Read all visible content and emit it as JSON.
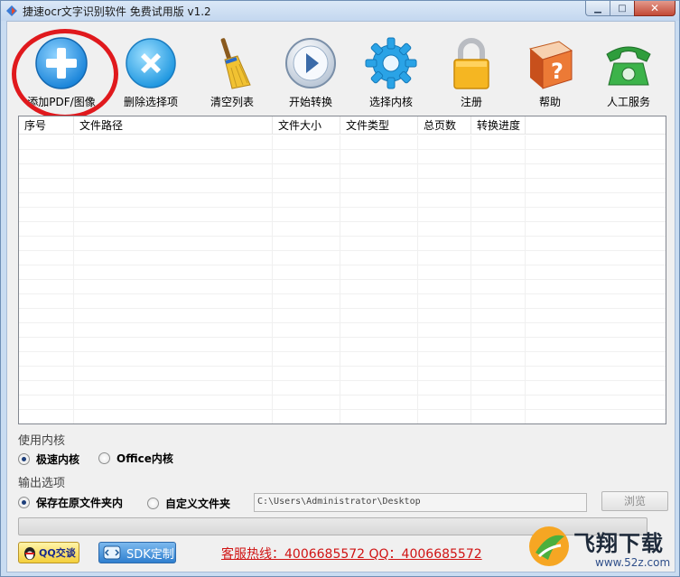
{
  "window": {
    "title": "捷速ocr文字识别软件 免费试用版 v1.2"
  },
  "toolbar": {
    "items": [
      {
        "label": "添加PDF/图像",
        "icon": "add-icon"
      },
      {
        "label": "删除选择项",
        "icon": "delete-icon"
      },
      {
        "label": "清空列表",
        "icon": "broom-icon"
      },
      {
        "label": "开始转换",
        "icon": "play-icon"
      },
      {
        "label": "选择内核",
        "icon": "gear-icon"
      },
      {
        "label": "注册",
        "icon": "lock-icon"
      },
      {
        "label": "帮助",
        "icon": "help-book-icon"
      },
      {
        "label": "人工服务",
        "icon": "phone-icon"
      }
    ]
  },
  "table": {
    "columns": [
      "序号",
      "文件路径",
      "文件大小",
      "文件类型",
      "总页数",
      "转换进度"
    ],
    "rows": []
  },
  "engine": {
    "section_label": "使用内核",
    "options": [
      {
        "label": "极速内核",
        "checked": true
      },
      {
        "label": "Office内核",
        "checked": false
      }
    ]
  },
  "output": {
    "section_label": "输出选项",
    "options": [
      {
        "label": "保存在原文件夹内",
        "checked": true
      },
      {
        "label": "自定义文件夹",
        "checked": false
      }
    ],
    "path": "C:\\Users\\Administrator\\Desktop",
    "browse_label": "浏览"
  },
  "progress": {
    "value": 0
  },
  "footer": {
    "qq_label": "QQ交谈",
    "sdk_label": "SDK定制",
    "hotline": "客服热线：4006685572 QQ：4006685572"
  },
  "watermark": {
    "text": "飞翔下载",
    "url": "www.52z.com"
  },
  "colors": {
    "accent_red": "#e0191d",
    "hotline_red": "#d01414",
    "titlebar_blue": "#c3d7ef"
  }
}
